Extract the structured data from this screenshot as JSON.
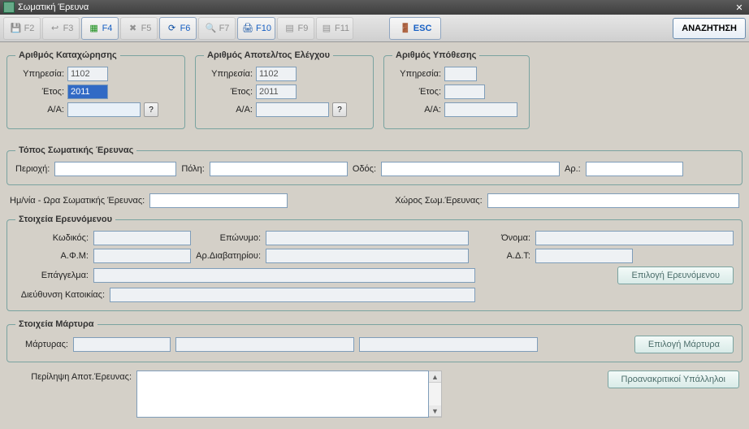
{
  "window": {
    "title": "Σωματική Έρευνα"
  },
  "toolbar": {
    "f2": "F2",
    "f3": "F3",
    "f4": "F4",
    "f5": "F5",
    "f6": "F6",
    "f7": "F7",
    "f10": "F10",
    "f9": "F9",
    "f11": "F11",
    "esc": "ESC",
    "search": "ΑΝΑΖΗΤΗΣΗ"
  },
  "reg": {
    "legend": "Αριθμός Καταχώρησης",
    "service_label": "Υπηρεσία:",
    "service_value": "1102",
    "year_label": "Έτος:",
    "year_value": "2011",
    "aa_label": "Α/Α:",
    "aa_value": "",
    "q": "?"
  },
  "check": {
    "legend": "Αριθμός Αποτελ/τος Ελέγχου",
    "service_label": "Υπηρεσία:",
    "service_value": "1102",
    "year_label": "Έτος:",
    "year_value": "2011",
    "aa_label": "Α/Α:",
    "aa_value": "",
    "q": "?"
  },
  "case": {
    "legend": "Αριθμός Υπόθεσης",
    "service_label": "Υπηρεσία:",
    "service_value": "",
    "year_label": "Έτος:",
    "year_value": "",
    "aa_label": "Α/Α:",
    "aa_value": ""
  },
  "place": {
    "legend": "Τόπος Σωματικής Έρευνας",
    "area_label": "Περιοχή:",
    "area_value": "",
    "city_label": "Πόλη:",
    "city_value": "",
    "street_label": "Οδός:",
    "street_value": "",
    "no_label": "Αρ.:",
    "no_value": ""
  },
  "datetime": {
    "label": "Ημ/νία - Ωρα Σωματικής Έρευνας:",
    "value": "",
    "space_label": "Χώρος Σωμ.Έρευνας:",
    "space_value": ""
  },
  "subject": {
    "legend": "Στοιχεία Ερευνόμενου",
    "code_label": "Κωδικός:",
    "code_value": "",
    "surname_label": "Επώνυμο:",
    "surname_value": "",
    "name_label": "Όνομα:",
    "name_value": "",
    "afm_label": "Α.Φ.Μ:",
    "afm_value": "",
    "passport_label": "Αρ.Διαβατηρίου:",
    "passport_value": "",
    "adt_label": "Α.Δ.Τ:",
    "adt_value": "",
    "job_label": "Επάγγελμα:",
    "job_value": "",
    "address_label": "Διεύθυνση Κατοικίας:",
    "address_value": "",
    "select_btn": "Επιλογή Ερευνόμενου"
  },
  "witness": {
    "legend": "Στοιχεία Μάρτυρα",
    "label": "Μάρτυρας:",
    "v1": "",
    "v2": "",
    "v3": "",
    "select_btn": "Επιλογή Μάρτυρα"
  },
  "summary": {
    "label": "Περίληψη Αποτ.Έρευνας:",
    "value": "",
    "officers_btn": "Προανακριτικοί Υπάλληλοι"
  }
}
